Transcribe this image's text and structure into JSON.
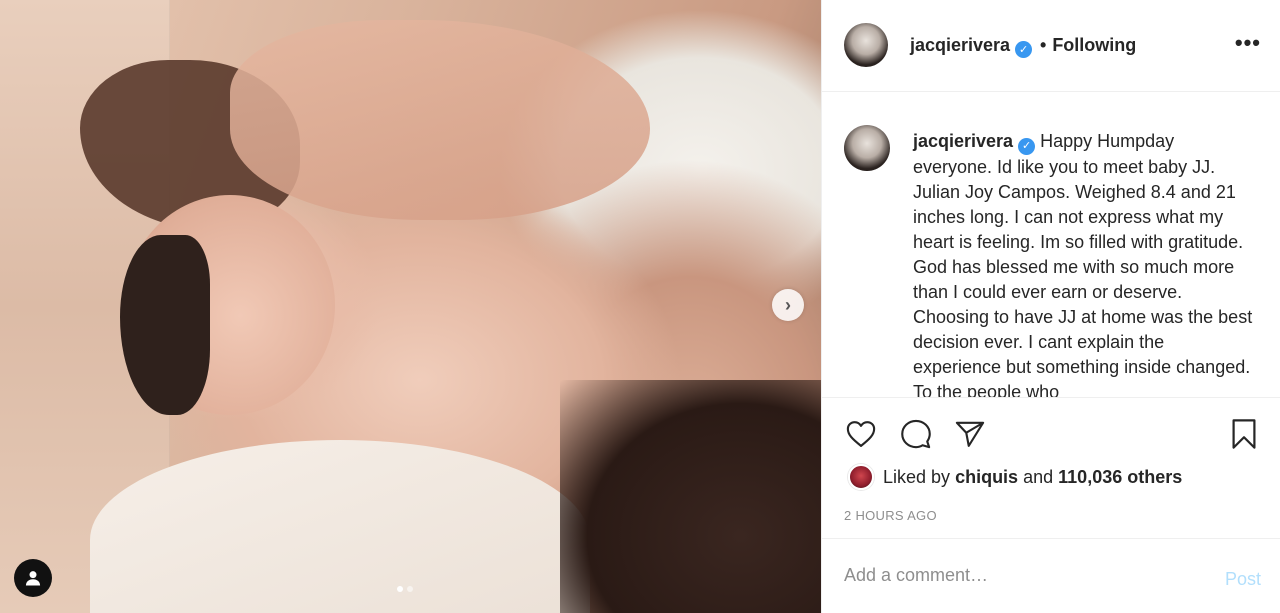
{
  "post": {
    "username": "jacqierivera",
    "follow_status": "Following",
    "follow_separator": "•",
    "more_label": "•••",
    "caption": "Happy Humpday everyone. Id like you to meet baby JJ. Julian Joy Campos. Weighed 8.4 and 21 inches long. I can not express what my heart is feeling. Im so filled with gratitude. God has blessed me with so much more than I could ever earn or deserve. Choosing to have JJ at home was the best decision ever. I cant explain the experience but something inside changed. To the people who",
    "carousel": {
      "slide_count": 2,
      "active_index": 0,
      "next_icon": "chevron-right-icon",
      "next_glyph": "›"
    },
    "image_description": "newborn baby on mother's chest"
  },
  "likes": {
    "prefix": "Liked by",
    "user": "chiquis",
    "middle": "and",
    "count_text": "110,036 others"
  },
  "timestamp": "2 HOURS AGO",
  "comment": {
    "placeholder": "Add a comment…",
    "post_label": "Post"
  },
  "icons": {
    "like": "heart-icon",
    "comment": "comment-icon",
    "share": "paper-plane-icon",
    "save": "bookmark-icon",
    "tag": "user-tag-icon"
  },
  "colors": {
    "verified": "#3897f0",
    "post_button_disabled": "#b2dffc",
    "muted_text": "#8e8e8e",
    "border": "#efefef"
  }
}
